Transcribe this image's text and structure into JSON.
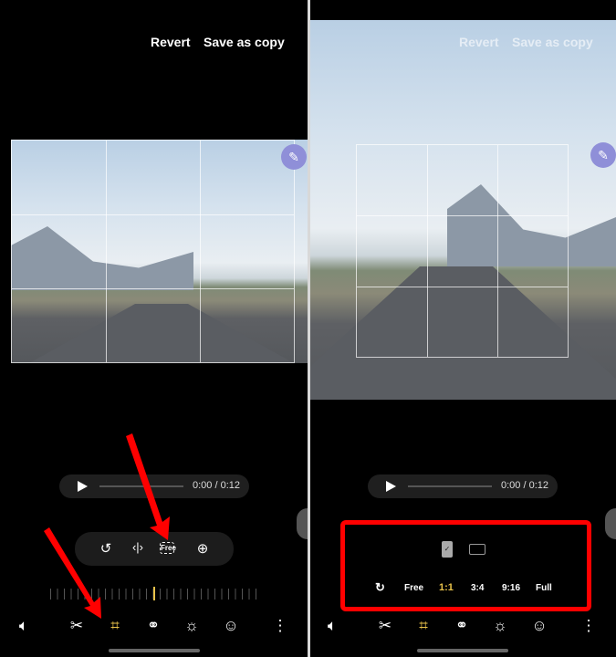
{
  "left": {
    "header": {
      "revert": "Revert",
      "save_copy": "Save as copy"
    },
    "player": {
      "time": "0:00 / 0:12"
    },
    "tools": {
      "rotate": "rotate-icon",
      "flip": "flip-icon",
      "free_label": "Free",
      "keystone": "perspective-icon"
    },
    "nav": [
      "volume-icon",
      "scissors-icon",
      "crop-rotate-icon",
      "filters-icon",
      "brightness-icon",
      "sticker-icon",
      "more-icon"
    ]
  },
  "right": {
    "header": {
      "revert": "Revert",
      "save_copy": "Save as copy"
    },
    "player": {
      "time": "0:00 / 0:12"
    },
    "ratios": {
      "reset": "↻",
      "free": "Free",
      "r11": "1:1",
      "r34": "3:4",
      "r916": "9:16",
      "full": "Full",
      "selected": "1:1"
    },
    "nav": [
      "volume-icon",
      "scissors-icon",
      "crop-rotate-icon",
      "filters-icon",
      "brightness-icon",
      "sticker-icon",
      "more-icon"
    ]
  },
  "colors": {
    "accent": "#e8c24a",
    "annotation": "#ff0000"
  }
}
